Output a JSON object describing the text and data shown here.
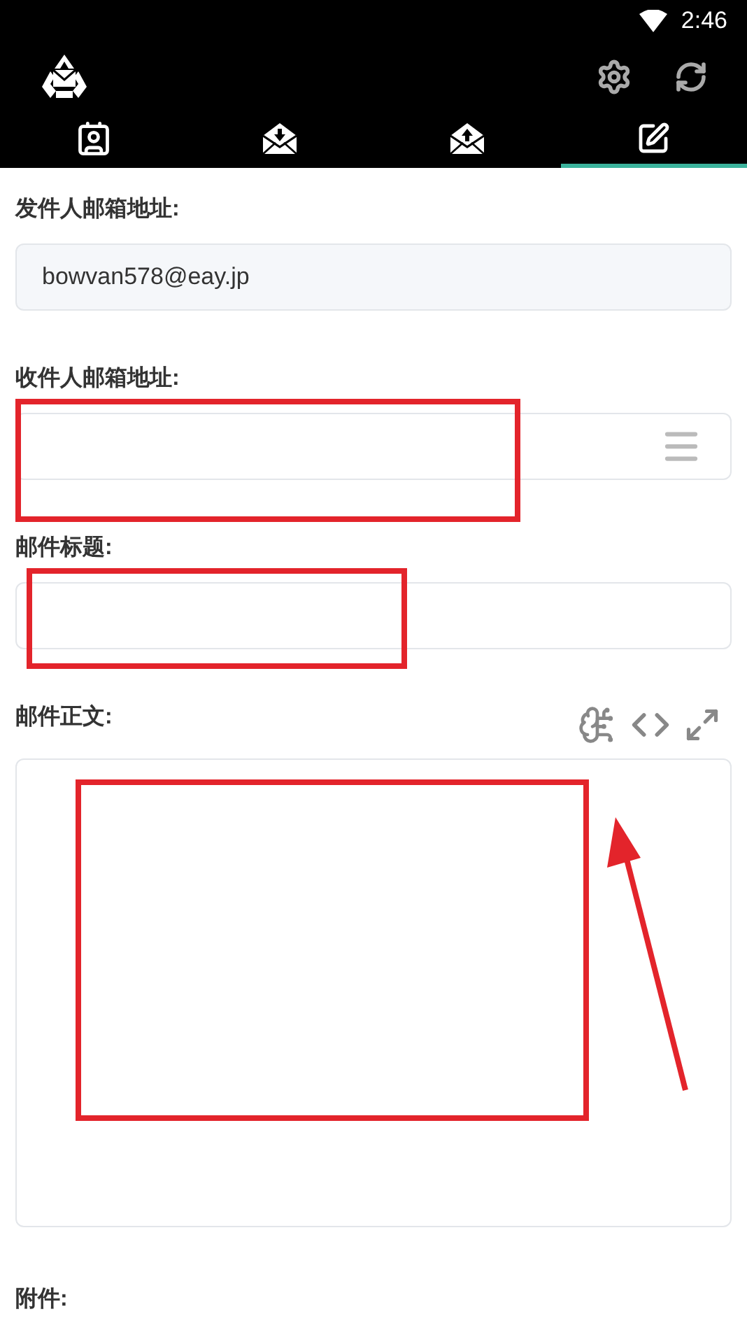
{
  "status_bar": {
    "time": "2:46"
  },
  "tabs": [
    {
      "selected": false
    },
    {
      "selected": false
    },
    {
      "selected": false
    },
    {
      "selected": true
    }
  ],
  "fields": [
    {
      "kind": "text",
      "label": "发件人邮箱地址:",
      "value": "bowvan578@eay.jp"
    },
    {
      "kind": "list",
      "label": "收件人邮箱地址:"
    },
    {
      "kind": "text",
      "label": "邮件标题:"
    },
    {
      "kind": "editor",
      "label": "邮件正文:"
    },
    {
      "kind": "attachment",
      "label": "附件:"
    }
  ]
}
